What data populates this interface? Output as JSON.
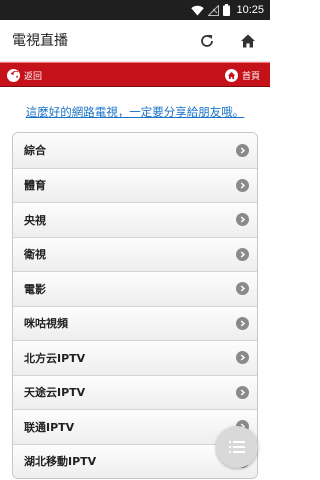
{
  "status_bar": {
    "time": "10:25",
    "icons": [
      "wifi-icon",
      "signal-off-icon",
      "battery-icon"
    ]
  },
  "app_bar": {
    "title": "電視直播",
    "icons": [
      "refresh-icon",
      "home-icon"
    ]
  },
  "nav_strip": {
    "back_label": "返回",
    "home_label": "首頁",
    "background_color": "#c5121a"
  },
  "share_text": "這麼好的網路電視，一定要分享給朋友哦。",
  "channels": [
    {
      "label": "綜合"
    },
    {
      "label": "體育"
    },
    {
      "label": "央視"
    },
    {
      "label": "衛視"
    },
    {
      "label": "電影"
    },
    {
      "label": "咪咕視頻"
    },
    {
      "label": "北方云IPTV"
    },
    {
      "label": "天途云IPTV"
    },
    {
      "label": "联通IPTV"
    },
    {
      "label": "湖北移動IPTV"
    }
  ],
  "fab": {
    "icon": "list-icon"
  }
}
